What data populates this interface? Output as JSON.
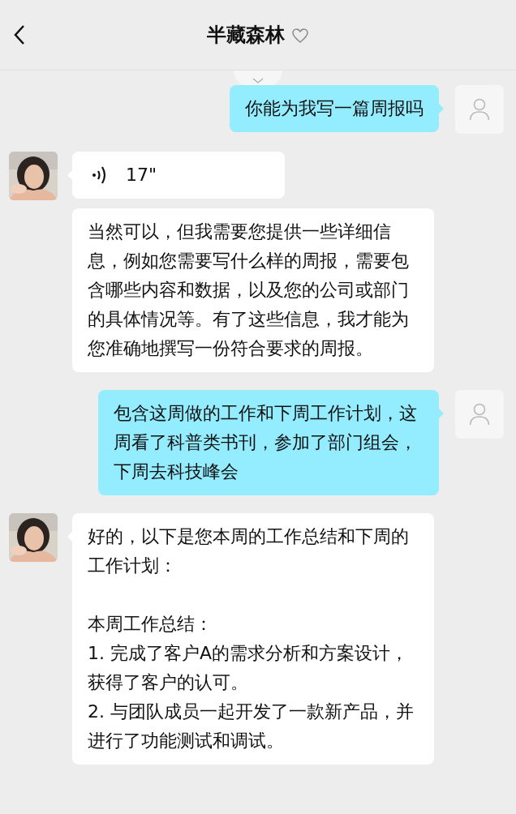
{
  "header": {
    "title": "半藏森林",
    "favorite": false
  },
  "messages": [
    {
      "outgoing": true,
      "kind": "text",
      "text": "你能为我写一篇周报吗"
    },
    {
      "outgoing": false,
      "kind": "voice",
      "text": "17\"",
      "show_avatar": true
    },
    {
      "outgoing": false,
      "kind": "text",
      "text": "当然可以，但我需要您提供一些详细信息，例如您需要写什么样的周报，需要包含哪些内容和数据，以及您的公司或部门的具体情况等。有了这些信息，我才能为您准确地撰写一份符合要求的周报。",
      "show_avatar": false
    },
    {
      "outgoing": true,
      "kind": "text",
      "text": "包含这周做的工作和下周工作计划，这周看了科普类书刊，参加了部门组会，下周去科技峰会"
    },
    {
      "outgoing": false,
      "kind": "summary",
      "intro": "好的，以下是您本周的工作总结和下周的工作计划：",
      "section_title": "本周工作总结：",
      "items": [
        "1. 完成了客户A的需求分析和方案设计，获得了客户的认可。",
        "2. 与团队成员一起开发了一款新产品，并进行了功能测试和调试。"
      ],
      "show_avatar": true
    }
  ]
}
